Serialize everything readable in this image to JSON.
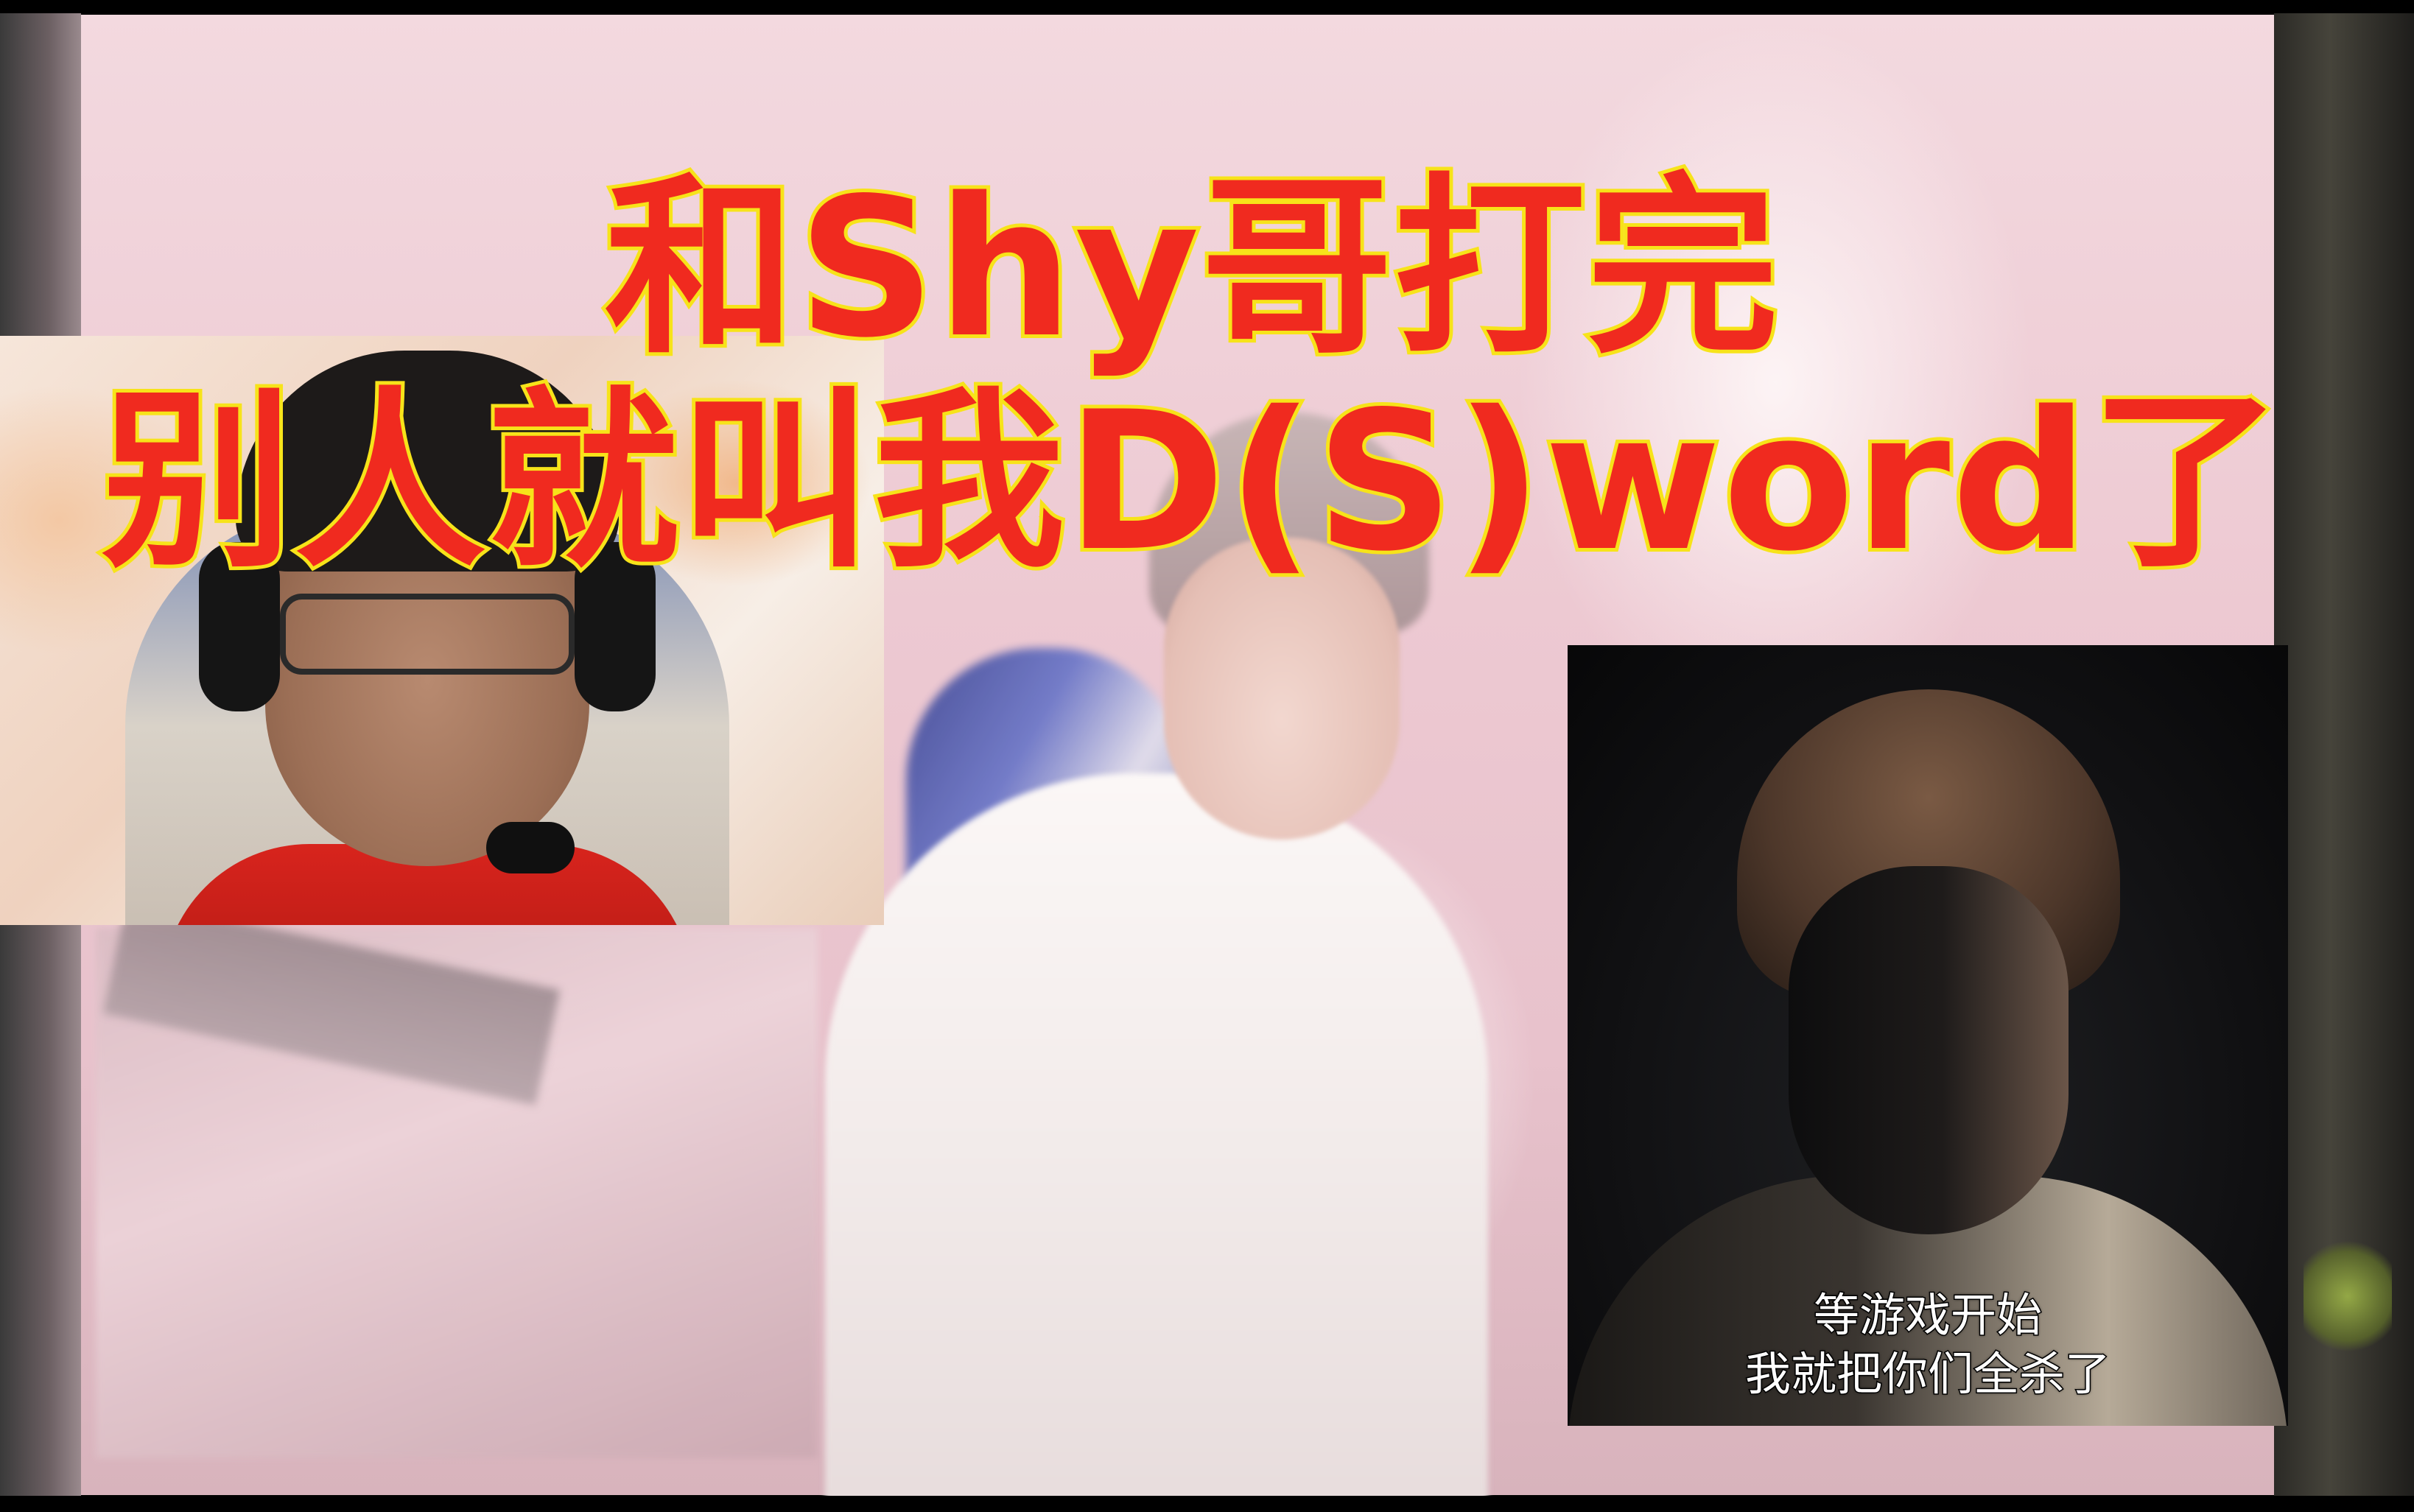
{
  "title": {
    "line1": "和Shy哥打完",
    "line2": "别人就叫我D(S)word了",
    "fill_color": "#f02a1f",
    "stroke_color": "#f7e31a"
  },
  "inset_right": {
    "caption_line1": "等游戏开始",
    "caption_line2": "我就把你们全杀了"
  }
}
